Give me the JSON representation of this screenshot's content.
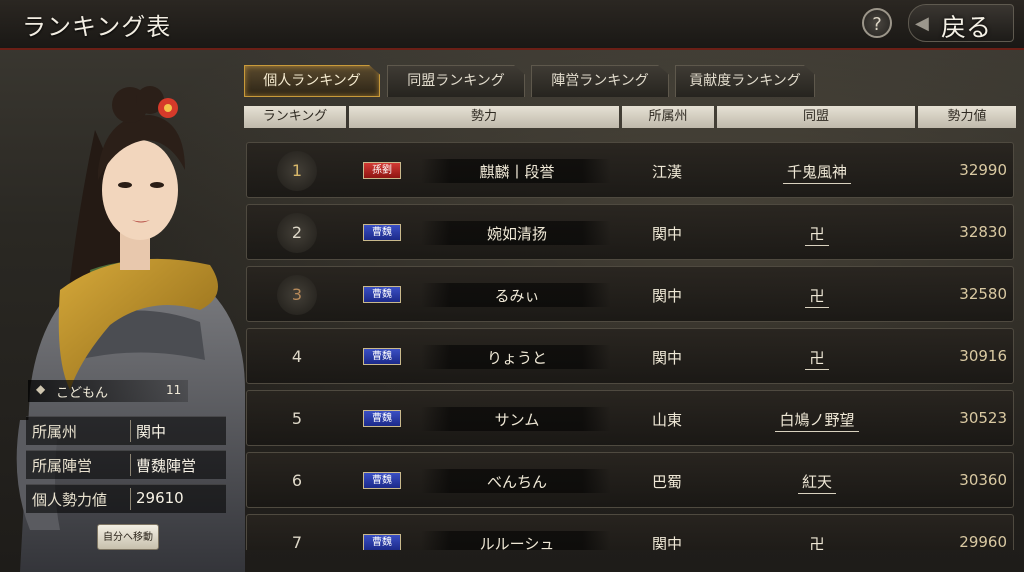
{
  "header": {
    "title": "ランキング表",
    "help_label": "?",
    "back_label": "戻る"
  },
  "tabs": [
    {
      "label": "個人ランキング",
      "active": true
    },
    {
      "label": "同盟ランキング",
      "active": false
    },
    {
      "label": "陣営ランキング",
      "active": false
    },
    {
      "label": "貢献度ランキング",
      "active": false
    }
  ],
  "columns": [
    "ランキング",
    "勢力",
    "所属州",
    "同盟",
    "勢力値"
  ],
  "player": {
    "name": "こどもん",
    "level": "11",
    "region_label": "所属州",
    "region": "関中",
    "camp_label": "所属陣営",
    "camp": "曹魏陣営",
    "power_label": "個人勢力値",
    "power": "29610",
    "move_button": "自分へ移動"
  },
  "rows": [
    {
      "rank": "1",
      "faction": "孫劉",
      "faction_color": "#b52420",
      "name": "麒麟丨段誉",
      "region": "江漢",
      "alliance": "千鬼風神",
      "power": "32990"
    },
    {
      "rank": "2",
      "faction": "曹魏",
      "faction_color": "#2a3ca8",
      "name": "婉如清扬",
      "region": "関中",
      "alliance": "卍",
      "power": "32830"
    },
    {
      "rank": "3",
      "faction": "曹魏",
      "faction_color": "#2a3ca8",
      "name": "るみぃ",
      "region": "関中",
      "alliance": "卍",
      "power": "32580"
    },
    {
      "rank": "4",
      "faction": "曹魏",
      "faction_color": "#2a3ca8",
      "name": "りょうと",
      "region": "関中",
      "alliance": "卍",
      "power": "30916"
    },
    {
      "rank": "5",
      "faction": "曹魏",
      "faction_color": "#2a3ca8",
      "name": "サンム",
      "region": "山東",
      "alliance": "白鳩ノ野望",
      "power": "30523"
    },
    {
      "rank": "6",
      "faction": "曹魏",
      "faction_color": "#2a3ca8",
      "name": "べんちん",
      "region": "巴蜀",
      "alliance": "紅天",
      "power": "30360"
    },
    {
      "rank": "7",
      "faction": "曹魏",
      "faction_color": "#2a3ca8",
      "name": "ルルーシュ",
      "region": "関中",
      "alliance": "卍",
      "power": "29960"
    }
  ]
}
